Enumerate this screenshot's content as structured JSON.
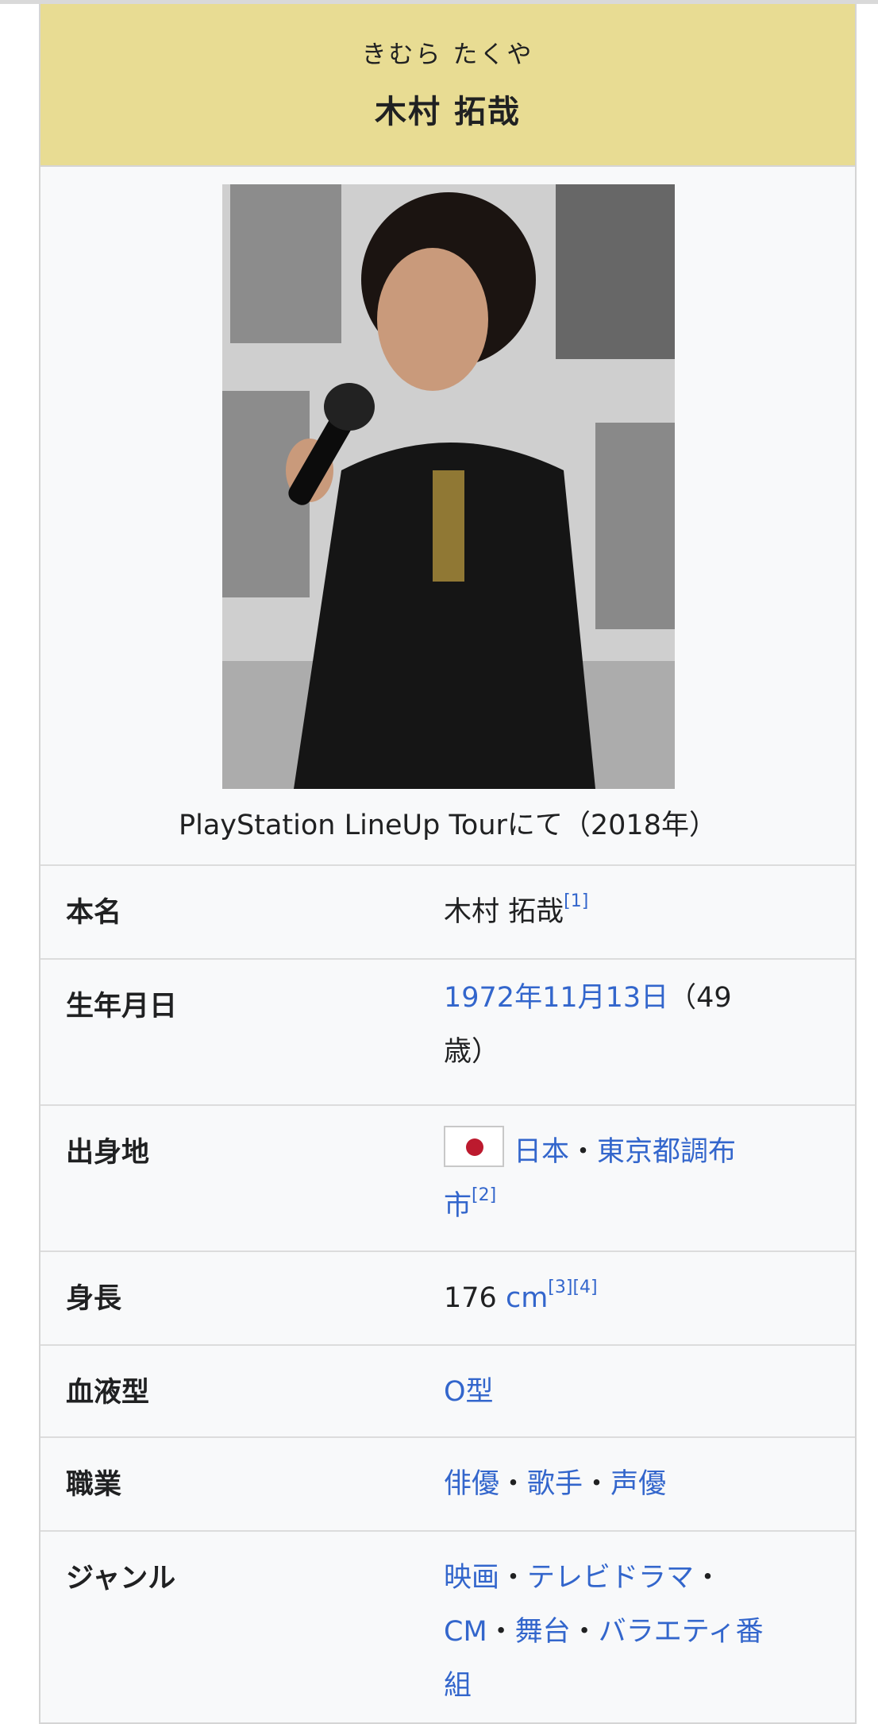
{
  "header": {
    "ruby": "きむら たくや",
    "name": "木村 拓哉"
  },
  "image": {
    "caption": "PlayStation LineUp Tourにて（2018年）"
  },
  "rows": [
    {
      "label": "本名",
      "value": "木村 拓哉",
      "refs": "[1]"
    },
    {
      "label": "生年月日",
      "date_link": "1972年11月13日",
      "suffix": "（49",
      "suffix2": "歳）"
    },
    {
      "label": "出身地",
      "links": [
        "日本",
        "東京都調布",
        "市"
      ],
      "sep": "・",
      "refs": "[2]"
    },
    {
      "label": "身長",
      "value": "176",
      "unit_link": "cm",
      "refs": "[3][4]"
    },
    {
      "label": "血液型",
      "link": "O型"
    },
    {
      "label": "職業",
      "links": [
        "俳優",
        "歌手",
        "声優"
      ],
      "sep": "・"
    },
    {
      "label": "ジャンル",
      "links": [
        "映画",
        "テレビドラマ",
        "CM",
        "舞台",
        "バラエティ番",
        "組"
      ],
      "sep": "・"
    }
  ],
  "icons": {
    "flag": "japan-flag-icon"
  },
  "colors": {
    "header_bg": "#e8dc93",
    "link": "#3366cc",
    "flag_red": "#bc1a2e"
  }
}
